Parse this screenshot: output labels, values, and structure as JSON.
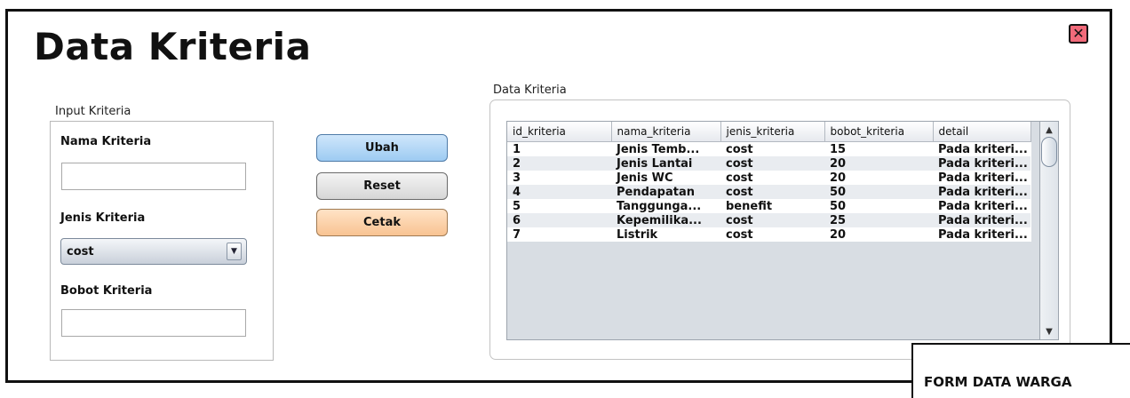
{
  "window": {
    "title": "Data Kriteria",
    "close_glyph": "✕"
  },
  "input_group": {
    "label": "Input Kriteria",
    "nama_label": "Nama Kriteria",
    "nama_value": "",
    "jenis_label": "Jenis Kriteria",
    "jenis_value": "cost",
    "bobot_label": "Bobot Kriteria",
    "bobot_value": ""
  },
  "buttons": {
    "ubah": "Ubah",
    "reset": "Reset",
    "cetak": "Cetak"
  },
  "table_group": {
    "label": "Data Kriteria",
    "columns": [
      "id_kriteria",
      "nama_kriteria",
      "jenis_kriteria",
      "bobot_kriteria",
      "detail"
    ],
    "rows": [
      [
        "1",
        "Jenis Temb...",
        "cost",
        "15",
        "Pada kriteri..."
      ],
      [
        "2",
        "Jenis Lantai",
        "cost",
        "20",
        "Pada kriteri..."
      ],
      [
        "3",
        "Jenis WC",
        "cost",
        "20",
        "Pada kriteri..."
      ],
      [
        "4",
        "Pendapatan",
        "cost",
        "50",
        "Pada kriteri..."
      ],
      [
        "5",
        "Tanggunga...",
        "benefit",
        "50",
        "Pada kriteri..."
      ],
      [
        "6",
        "Kepemilika...",
        "cost",
        "25",
        "Pada kriteri..."
      ],
      [
        "7",
        "Listrik",
        "cost",
        "20",
        "Pada kriteri..."
      ]
    ]
  },
  "scroll": {
    "up_glyph": "▲",
    "down_glyph": "▼"
  },
  "dropdown_glyph": "▼",
  "bottom_card": {
    "label": "FORM DATA WARGA"
  }
}
